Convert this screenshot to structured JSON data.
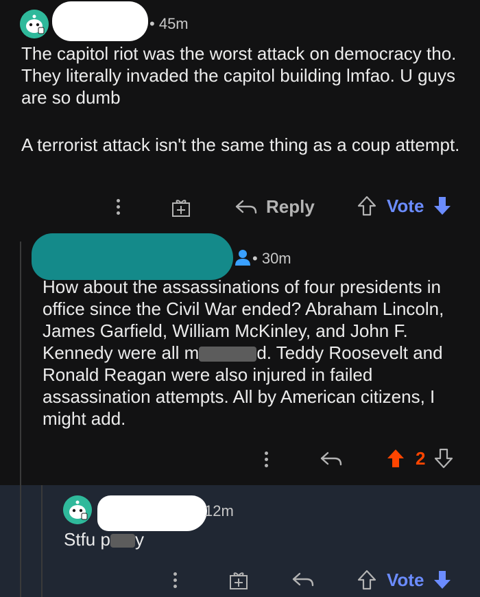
{
  "comment1": {
    "time": "45m",
    "paragraph1": "The capitol riot was the worst attack on democracy tho. They literally invaded the capitol building lmfao. U guys are so dumb",
    "paragraph2": "A terrorist attack isn't the same thing as a coup attempt.",
    "reply_label": "Reply",
    "vote_label": "Vote"
  },
  "comment2": {
    "time": "30m",
    "text_before": "How about the assassinations of four presidents in office since the Civil War ended? Abraham Lincoln, James Garfield, William McKinley, and John F. Kennedy were all m",
    "text_after": "d. Teddy Roosevelt and Ronald Reagan were also injured in failed assassination attempts. All by American citizens, I might add.",
    "vote_count": "2"
  },
  "comment3": {
    "time": "12m",
    "text_before": "Stfu p",
    "text_after": "y",
    "vote_label": "Vote"
  },
  "colors": {
    "background": "#121213",
    "highlight_background": "#202733",
    "vote_blue": "#6b8cff",
    "upvote_orange": "#ff4500",
    "avatar_green": "#2fb99b",
    "redaction_teal": "#148a8a"
  }
}
